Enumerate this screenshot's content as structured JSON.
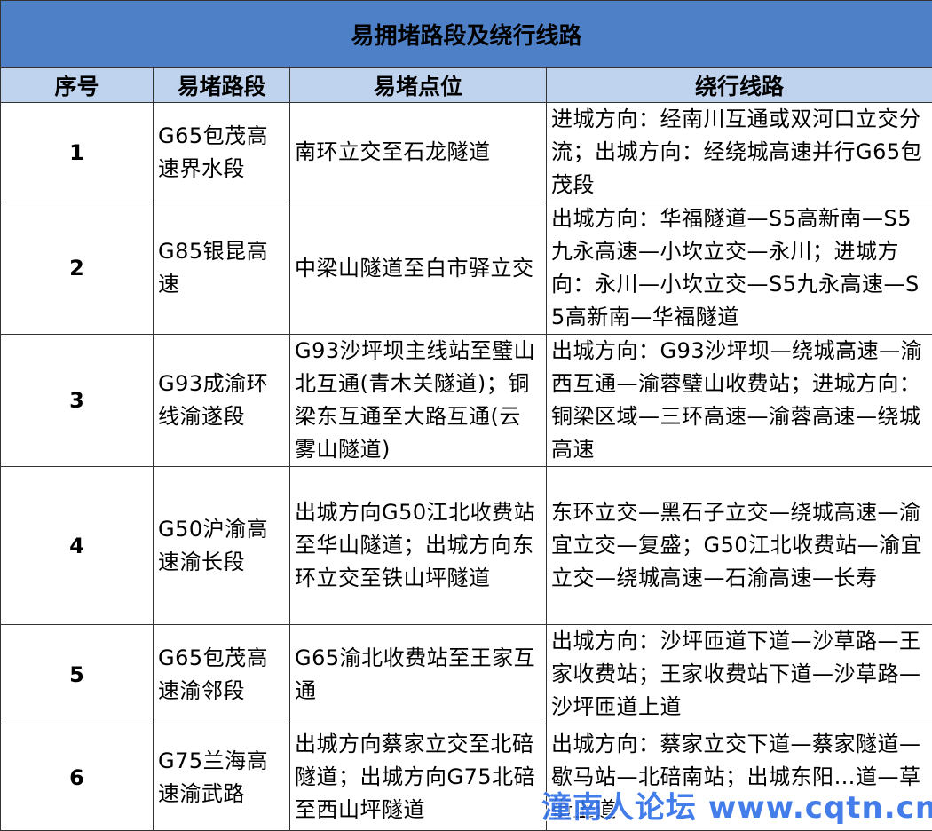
{
  "title": "易拥堵路段及绕行线路",
  "headers": [
    "序号",
    "易堵路段",
    "易堵点位",
    "绕行线路"
  ],
  "rows": [
    {
      "no": "1",
      "road": "G65包茂高速界水段",
      "spot": "南环立交至石龙隧道",
      "detour": "进城方向：经南川互通或双河口立交分流；出城方向：经绕城高速并行G65包茂段"
    },
    {
      "no": "2",
      "road": "G85银昆高速",
      "spot": "中梁山隧道至白市驿立交",
      "detour": "出城方向：华福隧道—S5高新南—S5九永高速—小坎立交—永川；进城方向：永川—小坎立交—S5九永高速—S5高新南—华福隧道"
    },
    {
      "no": "3",
      "road": "G93成渝环线渝遂段",
      "spot": "G93沙坪坝主线站至璧山北互通(青木关隧道)；铜梁东互通至大路互通(云雾山隧道)",
      "detour": "出城方向：G93沙坪坝—绕城高速—渝西互通—渝蓉璧山收费站；进城方向：铜梁区域—三环高速—渝蓉高速—绕城高速"
    },
    {
      "no": "4",
      "road": "G50沪渝高速渝长段",
      "spot": "出城方向G50江北收费站至华山隧道；出城方向东环立交至铁山坪隧道",
      "detour": "东环立交—黑石子立交—绕城高速—渝宜立交—复盛；G50江北收费站—渝宜立交—绕城高速—石渝高速—长寿"
    },
    {
      "no": "5",
      "road": "G65包茂高速渝邻段",
      "spot": "G65渝北收费站至王家互通",
      "detour": "出城方向：沙坪匝道下道—沙草路—王家收费站；王家收费站下道—沙草路—沙坪匝道上道"
    },
    {
      "no": "6",
      "road": "G75兰海高速渝武路",
      "spot": "出城方向蔡家立交至北碚隧道；出城方向G75北碚至西山坪隧道",
      "detour": "出城方向：蔡家立交下道—蔡家隧道—歇马站—北碚南站；出城东阳…道—草街上道"
    }
  ],
  "watermark": "潼南人论坛 www.cqtn.cn"
}
